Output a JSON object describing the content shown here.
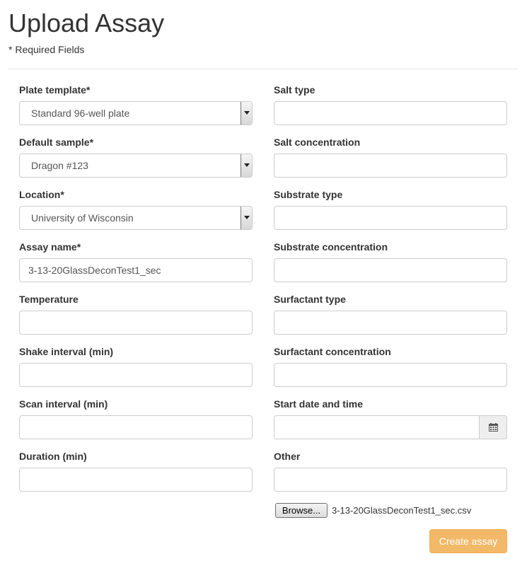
{
  "page": {
    "title": "Upload Assay",
    "required_note": "* Required Fields"
  },
  "left_fields": [
    {
      "label": "Plate template*",
      "value": "Standard 96-well plate"
    },
    {
      "label": "Default sample*",
      "value": "Dragon #123"
    },
    {
      "label": "Location*",
      "value": "University of Wisconsin"
    },
    {
      "label": "Assay name*",
      "value": "3-13-20GlassDeconTest1_sec"
    },
    {
      "label": "Temperature",
      "value": ""
    },
    {
      "label": "Shake interval (min)",
      "value": ""
    },
    {
      "label": "Scan interval (min)",
      "value": ""
    },
    {
      "label": "Duration (min)",
      "value": ""
    }
  ],
  "right_fields": [
    {
      "label": "Salt type",
      "value": ""
    },
    {
      "label": "Salt concentration",
      "value": ""
    },
    {
      "label": "Substrate type",
      "value": ""
    },
    {
      "label": "Substrate concentration",
      "value": ""
    },
    {
      "label": "Surfactant type",
      "value": ""
    },
    {
      "label": "Surfactant concentration",
      "value": ""
    },
    {
      "label": "Start date and time",
      "value": ""
    },
    {
      "label": "Other",
      "value": ""
    }
  ],
  "upload": {
    "browse_label": "Browse...",
    "file_name": "3-13-20GlassDeconTest1_sec.csv"
  },
  "actions": {
    "create_label": "Create assay"
  },
  "icons": {
    "date_picker": "calendar-icon",
    "select": "chevron-down-icon"
  },
  "colors": {
    "primary_button": "#f0ad4e",
    "border": "#cccccc"
  }
}
